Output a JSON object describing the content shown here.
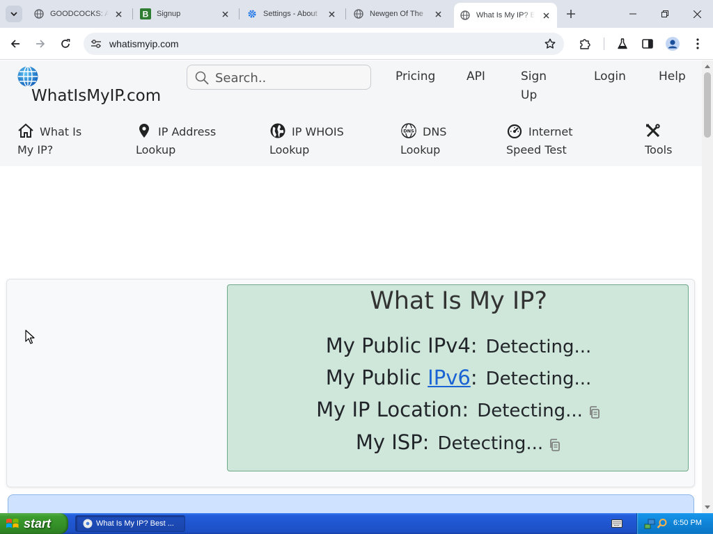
{
  "browser": {
    "tabs": [
      {
        "title": "GOODCOCKS: A",
        "icon": "globe-icon"
      },
      {
        "title": "Signup",
        "icon": "bootstrap-b-icon"
      },
      {
        "title": "Settings - About",
        "icon": "settings-gear-icon"
      },
      {
        "title": "Newgen Of The",
        "icon": "globe-icon"
      },
      {
        "title": "What Is My IP? B",
        "icon": "globe-icon",
        "active": true
      }
    ],
    "url": "whatismyip.com"
  },
  "site": {
    "logo_text": "WhatIsMyIP.com",
    "search_placeholder": "Search..",
    "top_nav": {
      "pricing": "Pricing",
      "api": "API",
      "signup_line1": "Sign",
      "signup_line2": "Up",
      "login": "Login",
      "help": "Help"
    },
    "main_nav": [
      {
        "line1": "What Is",
        "line2": "My IP?",
        "icon": "home-icon"
      },
      {
        "line1": "IP Address",
        "line2": "Lookup",
        "icon": "map-pin-icon"
      },
      {
        "line1": "IP WHOIS",
        "line2": "Lookup",
        "icon": "globe-icon"
      },
      {
        "line1": "DNS",
        "line2": "Lookup",
        "icon": "dns-globe-icon"
      },
      {
        "line1": "Internet",
        "line2": "Speed Test",
        "icon": "speedometer-icon"
      },
      {
        "line1": "",
        "line2": "Tools",
        "icon": "tools-icon"
      }
    ],
    "ip_card": {
      "title": "What Is My IP?",
      "ipv4_label": "My Public IPv4:",
      "ipv4_value": "Detecting...",
      "ipv6_prefix": "My Public ",
      "ipv6_link": "IPv6",
      "ipv6_suffix": ":",
      "ipv6_value": "Detecting...",
      "location_label": "My IP Location:",
      "location_value": "Detecting...",
      "isp_label": "My ISP:",
      "isp_value": "Detecting..."
    }
  },
  "taskbar": {
    "start_label": "start",
    "task_label": "What Is My IP? Best ...",
    "clock": "6:50 PM"
  },
  "colors": {
    "card_bg": "#cfe6da",
    "card_border": "#6fa888",
    "link": "#1a63d4",
    "taskbar": "#245edb",
    "start_button": "#3d9c2f"
  }
}
